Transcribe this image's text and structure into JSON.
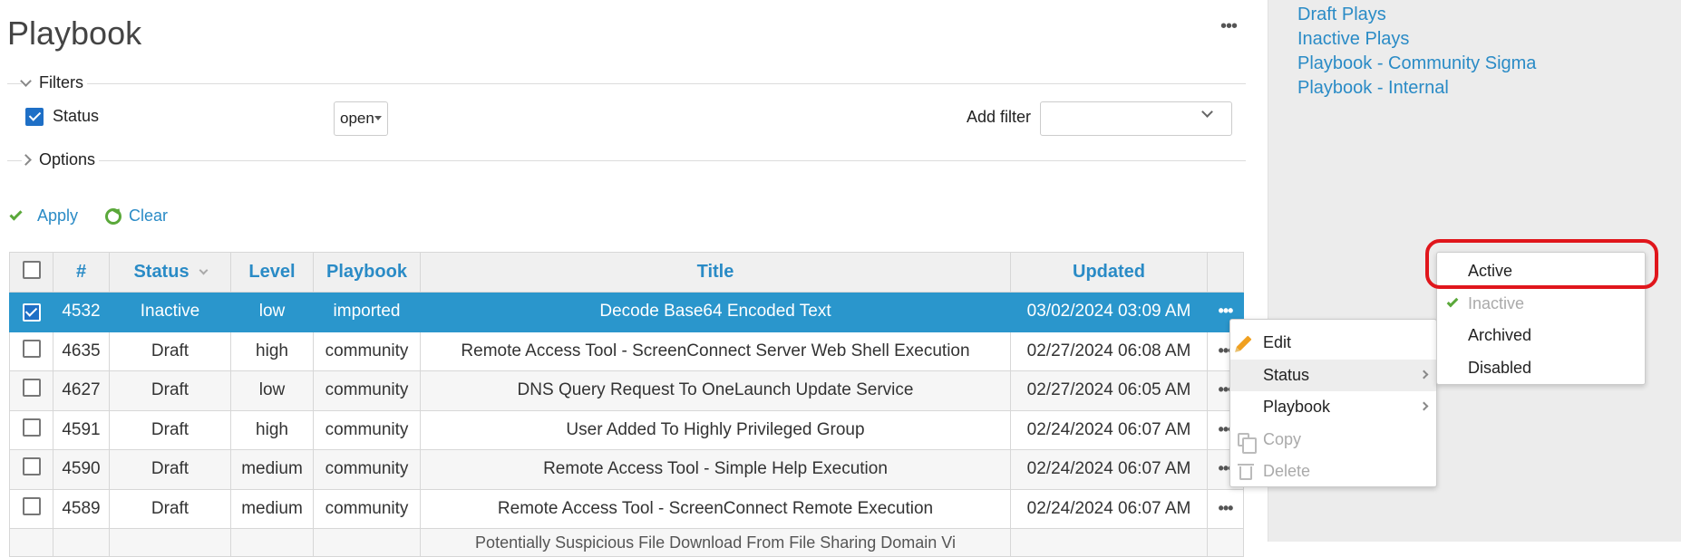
{
  "page": {
    "title": "Playbook",
    "menu_glyph": "•••"
  },
  "filters": {
    "legend": "Filters",
    "status_label": "Status",
    "status_value": "open",
    "add_filter_label": "Add filter",
    "add_filter_value": ""
  },
  "options": {
    "legend": "Options"
  },
  "actions": {
    "apply": "Apply",
    "clear": "Clear"
  },
  "table": {
    "headers": {
      "id": "#",
      "status": "Status",
      "level": "Level",
      "playbook": "Playbook",
      "title": "Title",
      "updated": "Updated"
    },
    "rows": [
      {
        "id": "4532",
        "status": "Inactive",
        "level": "low",
        "playbook": "imported",
        "title": "Decode Base64 Encoded Text",
        "updated": "03/02/2024 03:09 AM",
        "selected": true
      },
      {
        "id": "4635",
        "status": "Draft",
        "level": "high",
        "playbook": "community",
        "title": "Remote Access Tool - ScreenConnect Server Web Shell Execution",
        "updated": "02/27/2024 06:08 AM",
        "selected": false
      },
      {
        "id": "4627",
        "status": "Draft",
        "level": "low",
        "playbook": "community",
        "title": "DNS Query Request To OneLaunch Update Service",
        "updated": "02/27/2024 06:05 AM",
        "selected": false
      },
      {
        "id": "4591",
        "status": "Draft",
        "level": "high",
        "playbook": "community",
        "title": "User Added To Highly Privileged Group",
        "updated": "02/24/2024 06:07 AM",
        "selected": false
      },
      {
        "id": "4590",
        "status": "Draft",
        "level": "medium",
        "playbook": "community",
        "title": "Remote Access Tool - Simple Help Execution",
        "updated": "02/24/2024 06:07 AM",
        "selected": false
      },
      {
        "id": "4589",
        "status": "Draft",
        "level": "medium",
        "playbook": "community",
        "title": "Remote Access Tool - ScreenConnect Remote Execution",
        "updated": "02/24/2024 06:07 AM",
        "selected": false
      },
      {
        "id": "",
        "status": "",
        "level": "",
        "playbook": "",
        "title": "Potentially Suspicious File Download From File Sharing Domain Vi",
        "updated": "",
        "selected": false
      }
    ],
    "row_menu_glyph": "•••"
  },
  "sidebar": {
    "links": [
      "Draft Plays",
      "Inactive Plays",
      "Playbook - Community Sigma",
      "Playbook - Internal"
    ]
  },
  "context_menu": {
    "items": [
      {
        "label": "Edit",
        "icon": "pencil-icon",
        "disabled": false
      },
      {
        "label": "Status",
        "submenu": true,
        "disabled": false
      },
      {
        "label": "Playbook",
        "submenu": true,
        "disabled": false
      },
      {
        "label": "Copy",
        "icon": "copy-icon",
        "disabled": true
      },
      {
        "label": "Delete",
        "icon": "trash-icon",
        "disabled": true
      }
    ]
  },
  "status_submenu": {
    "items": [
      {
        "label": "Active",
        "current": false,
        "disabled": false
      },
      {
        "label": "Inactive",
        "current": true,
        "disabled": true
      },
      {
        "label": "Archived",
        "current": false,
        "disabled": false
      },
      {
        "label": "Disabled",
        "current": false,
        "disabled": false
      }
    ]
  },
  "colors": {
    "accent": "#2a8bc6",
    "selected_row": "#2a96cc",
    "highlight_ring": "#e0161c",
    "check_green": "#5aa83a"
  }
}
